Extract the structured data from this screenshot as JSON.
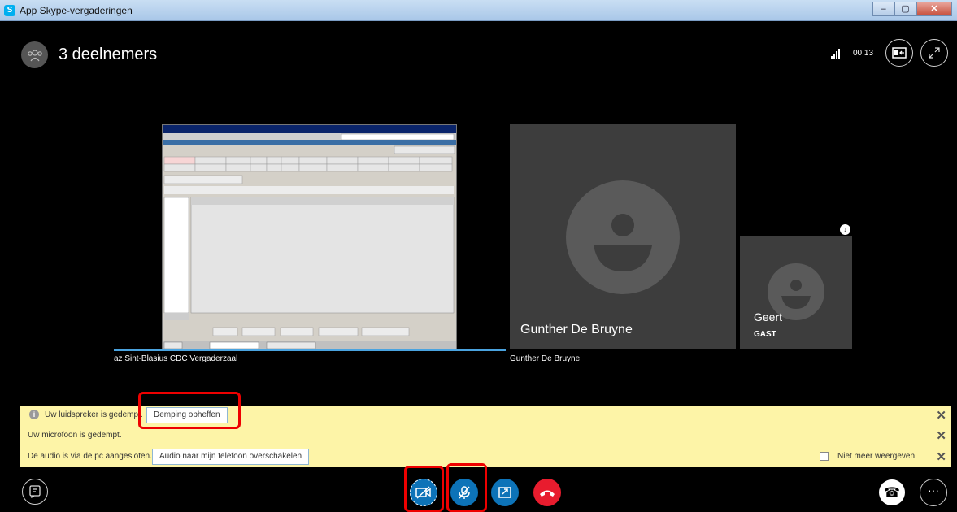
{
  "window": {
    "title": "App Skype-vergaderingen",
    "buttons": [
      "–",
      "▢",
      "✕"
    ]
  },
  "header": {
    "participants_label": "3 deelnemers",
    "call_time": "00:13"
  },
  "video": {
    "shared_screen_caption": "az Sint-Blasius CDC Vergaderzaal",
    "participants": [
      {
        "name": "Gunther De Bruyne",
        "caption": "Gunther De Bruyne"
      },
      {
        "name": "Geert",
        "role": "GAST"
      }
    ]
  },
  "notifications": [
    {
      "text": "Uw luidspreker is gedempt.",
      "button": "Demping opheffen",
      "close": "✕"
    },
    {
      "text": "Uw microfoon is gedempt.",
      "close": "✕"
    },
    {
      "text": "De audio is via de pc aangesloten.",
      "button": "Audio naar mijn telefoon overschakelen",
      "checkbox_label": "Niet meer weergeven",
      "close": "✕"
    }
  ],
  "controls": {
    "more_label": "···",
    "phone_label": "☎"
  },
  "colors": {
    "accent_blue": "#0d73b8",
    "hangup_red": "#e81c2e",
    "notice_yellow": "#fdf4a7",
    "highlight_red": "#ee0000"
  }
}
